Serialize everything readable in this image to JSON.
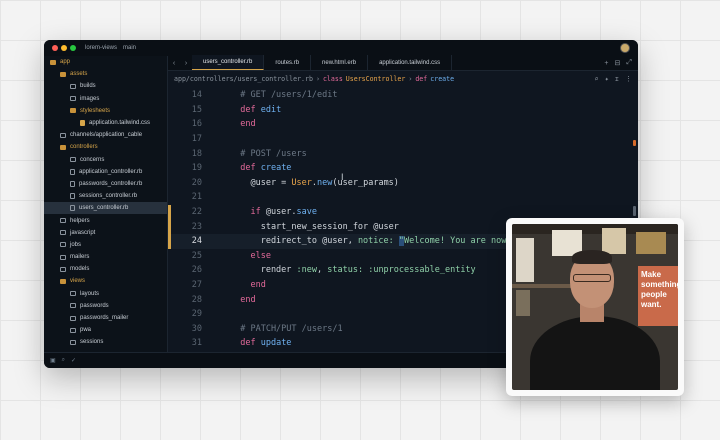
{
  "window": {
    "project": "lorem-views",
    "branch": "main"
  },
  "sidebar": {
    "items": [
      {
        "label": "app",
        "type": "folder",
        "indent": 1
      },
      {
        "label": "assets",
        "type": "folder",
        "indent": 2
      },
      {
        "label": "builds",
        "type": "dir",
        "indent": 3
      },
      {
        "label": "images",
        "type": "dir",
        "indent": 3
      },
      {
        "label": "stylesheets",
        "type": "folder",
        "indent": 3
      },
      {
        "label": "application.tailwind.css",
        "type": "css",
        "indent": 4
      },
      {
        "label": "channels/application_cable",
        "type": "dir",
        "indent": 2
      },
      {
        "label": "controllers",
        "type": "folder",
        "indent": 2
      },
      {
        "label": "concerns",
        "type": "dir",
        "indent": 3
      },
      {
        "label": "application_controller.rb",
        "type": "file",
        "indent": 3
      },
      {
        "label": "passwords_controller.rb",
        "type": "file",
        "indent": 3
      },
      {
        "label": "sessions_controller.rb",
        "type": "file",
        "indent": 3
      },
      {
        "label": "users_controller.rb",
        "type": "file",
        "indent": 3,
        "selected": true
      },
      {
        "label": "helpers",
        "type": "dir",
        "indent": 2
      },
      {
        "label": "javascript",
        "type": "dir",
        "indent": 2
      },
      {
        "label": "jobs",
        "type": "dir",
        "indent": 2
      },
      {
        "label": "mailers",
        "type": "dir",
        "indent": 2
      },
      {
        "label": "models",
        "type": "dir",
        "indent": 2
      },
      {
        "label": "views",
        "type": "folder",
        "indent": 2
      },
      {
        "label": "layouts",
        "type": "dir",
        "indent": 3
      },
      {
        "label": "passwords",
        "type": "dir",
        "indent": 3
      },
      {
        "label": "passwords_mailer",
        "type": "dir",
        "indent": 3
      },
      {
        "label": "pwa",
        "type": "dir",
        "indent": 3
      },
      {
        "label": "sessions",
        "type": "dir",
        "indent": 3
      }
    ]
  },
  "tabs": [
    {
      "label": "users_controller.rb",
      "active": true
    },
    {
      "label": "routes.rb",
      "active": false
    },
    {
      "label": "new.html.erb",
      "active": false
    },
    {
      "label": "application.tailwind.css",
      "active": false
    }
  ],
  "breadcrumb": {
    "path": "app/controllers/users_controller.rb",
    "sep": "›",
    "kw1": "class",
    "cls": "UsersController",
    "sep2": "›",
    "kw2": "def",
    "fn": "create"
  },
  "code": {
    "current_line": 24,
    "lines": [
      {
        "n": "14",
        "tokens": [
          [
            "c",
            "  # GET /users/1/edit"
          ]
        ]
      },
      {
        "n": "15",
        "tokens": [
          [
            "k",
            "  def "
          ],
          [
            "f",
            "edit"
          ]
        ]
      },
      {
        "n": "16",
        "tokens": [
          [
            "k",
            "  end"
          ]
        ]
      },
      {
        "n": "17",
        "tokens": []
      },
      {
        "n": "18",
        "tokens": [
          [
            "c",
            "  # POST /users"
          ]
        ]
      },
      {
        "n": "19",
        "tokens": [
          [
            "k",
            "  def "
          ],
          [
            "f",
            "create"
          ]
        ]
      },
      {
        "n": "20",
        "tokens": [
          [
            "i",
            "    @user = "
          ],
          [
            "cl",
            "User"
          ],
          [
            "i",
            "."
          ],
          [
            "f",
            "new"
          ],
          [
            "i",
            "(user_params)"
          ]
        ]
      },
      {
        "n": "21",
        "tokens": []
      },
      {
        "n": "22",
        "tokens": [
          [
            "k",
            "    if "
          ],
          [
            "i",
            "@user."
          ],
          [
            "f",
            "save"
          ]
        ]
      },
      {
        "n": "23",
        "tokens": [
          [
            "i",
            "      start_new_session_for @user"
          ]
        ]
      },
      {
        "n": "24",
        "tokens": [
          [
            "i",
            "      redirect_to @user, "
          ],
          [
            "y",
            "notice: "
          ],
          [
            "sel",
            "\""
          ],
          [
            "s",
            "Welcome! You are now s"
          ]
        ]
      },
      {
        "n": "25",
        "tokens": [
          [
            "k",
            "    else"
          ]
        ]
      },
      {
        "n": "26",
        "tokens": [
          [
            "i",
            "      render "
          ],
          [
            "y",
            ":new"
          ],
          [
            "i",
            ", "
          ],
          [
            "y",
            "status: :unprocessable_entity"
          ]
        ]
      },
      {
        "n": "27",
        "tokens": [
          [
            "k",
            "    end"
          ]
        ]
      },
      {
        "n": "28",
        "tokens": [
          [
            "k",
            "  end"
          ]
        ]
      },
      {
        "n": "29",
        "tokens": []
      },
      {
        "n": "30",
        "tokens": [
          [
            "c",
            "  # PATCH/PUT /users/1"
          ]
        ]
      },
      {
        "n": "31",
        "tokens": [
          [
            "k",
            "  def "
          ],
          [
            "f",
            "update"
          ]
        ]
      }
    ]
  },
  "webcam": {
    "poster_text": "Make something people want."
  },
  "icons": {
    "back": "chevron-left-icon",
    "forward": "chevron-right-icon",
    "new_tab": "plus-icon",
    "split": "split-icon",
    "expand": "expand-icon"
  }
}
